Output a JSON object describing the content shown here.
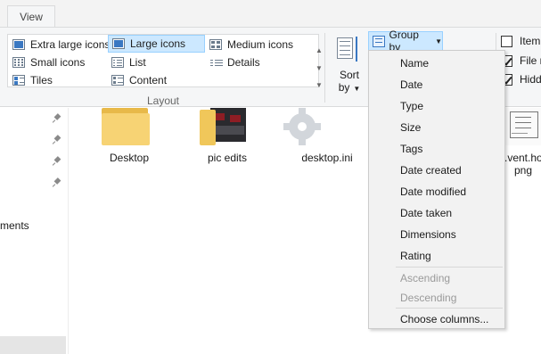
{
  "tabs": {
    "view": "View"
  },
  "layout": {
    "items": [
      {
        "label": "Extra large icons",
        "icon": "extra-large-icons-icon"
      },
      {
        "label": "Large icons",
        "icon": "large-icons-icon",
        "selected": true
      },
      {
        "label": "Medium icons",
        "icon": "medium-icons-icon"
      },
      {
        "label": "Small icons",
        "icon": "small-icons-icon"
      },
      {
        "label": "List",
        "icon": "list-icon"
      },
      {
        "label": "Details",
        "icon": "details-icon"
      },
      {
        "label": "Tiles",
        "icon": "tiles-icon"
      },
      {
        "label": "Content",
        "icon": "content-icon"
      }
    ],
    "group_label": "Layout"
  },
  "current_view": {
    "sort_by_line1": "Sort",
    "sort_by_line2": "by",
    "group_by": "Group by"
  },
  "show_hide": {
    "item_checkboxes": {
      "label": "Item",
      "checked": false
    },
    "file_name_extensions": {
      "label": "File n",
      "checked": true
    },
    "hidden_items": {
      "label": "Hidd",
      "checked": true
    }
  },
  "nav": {
    "partial_item": "ments"
  },
  "files": [
    {
      "name": "Desktop",
      "type": "folder"
    },
    {
      "name": "pic edits",
      "type": "folder-photo"
    },
    {
      "name": "desktop.ini",
      "type": "settings-file"
    },
    {
      "name_line1": ".vent.ho",
      "name_line2": "png",
      "type": "image-file"
    }
  ],
  "group_by_menu": {
    "items": [
      "Name",
      "Date",
      "Type",
      "Size",
      "Tags",
      "Date created",
      "Date modified",
      "Date taken",
      "Dimensions",
      "Rating"
    ],
    "order": [
      "Ascending",
      "Descending"
    ],
    "choose_columns": "Choose columns..."
  },
  "colors": {
    "selection_fill": "#cce8ff",
    "selection_border": "#99d1ff",
    "ribbon_bg": "#f5f6f7",
    "menu_bg": "#f2f2f2"
  }
}
